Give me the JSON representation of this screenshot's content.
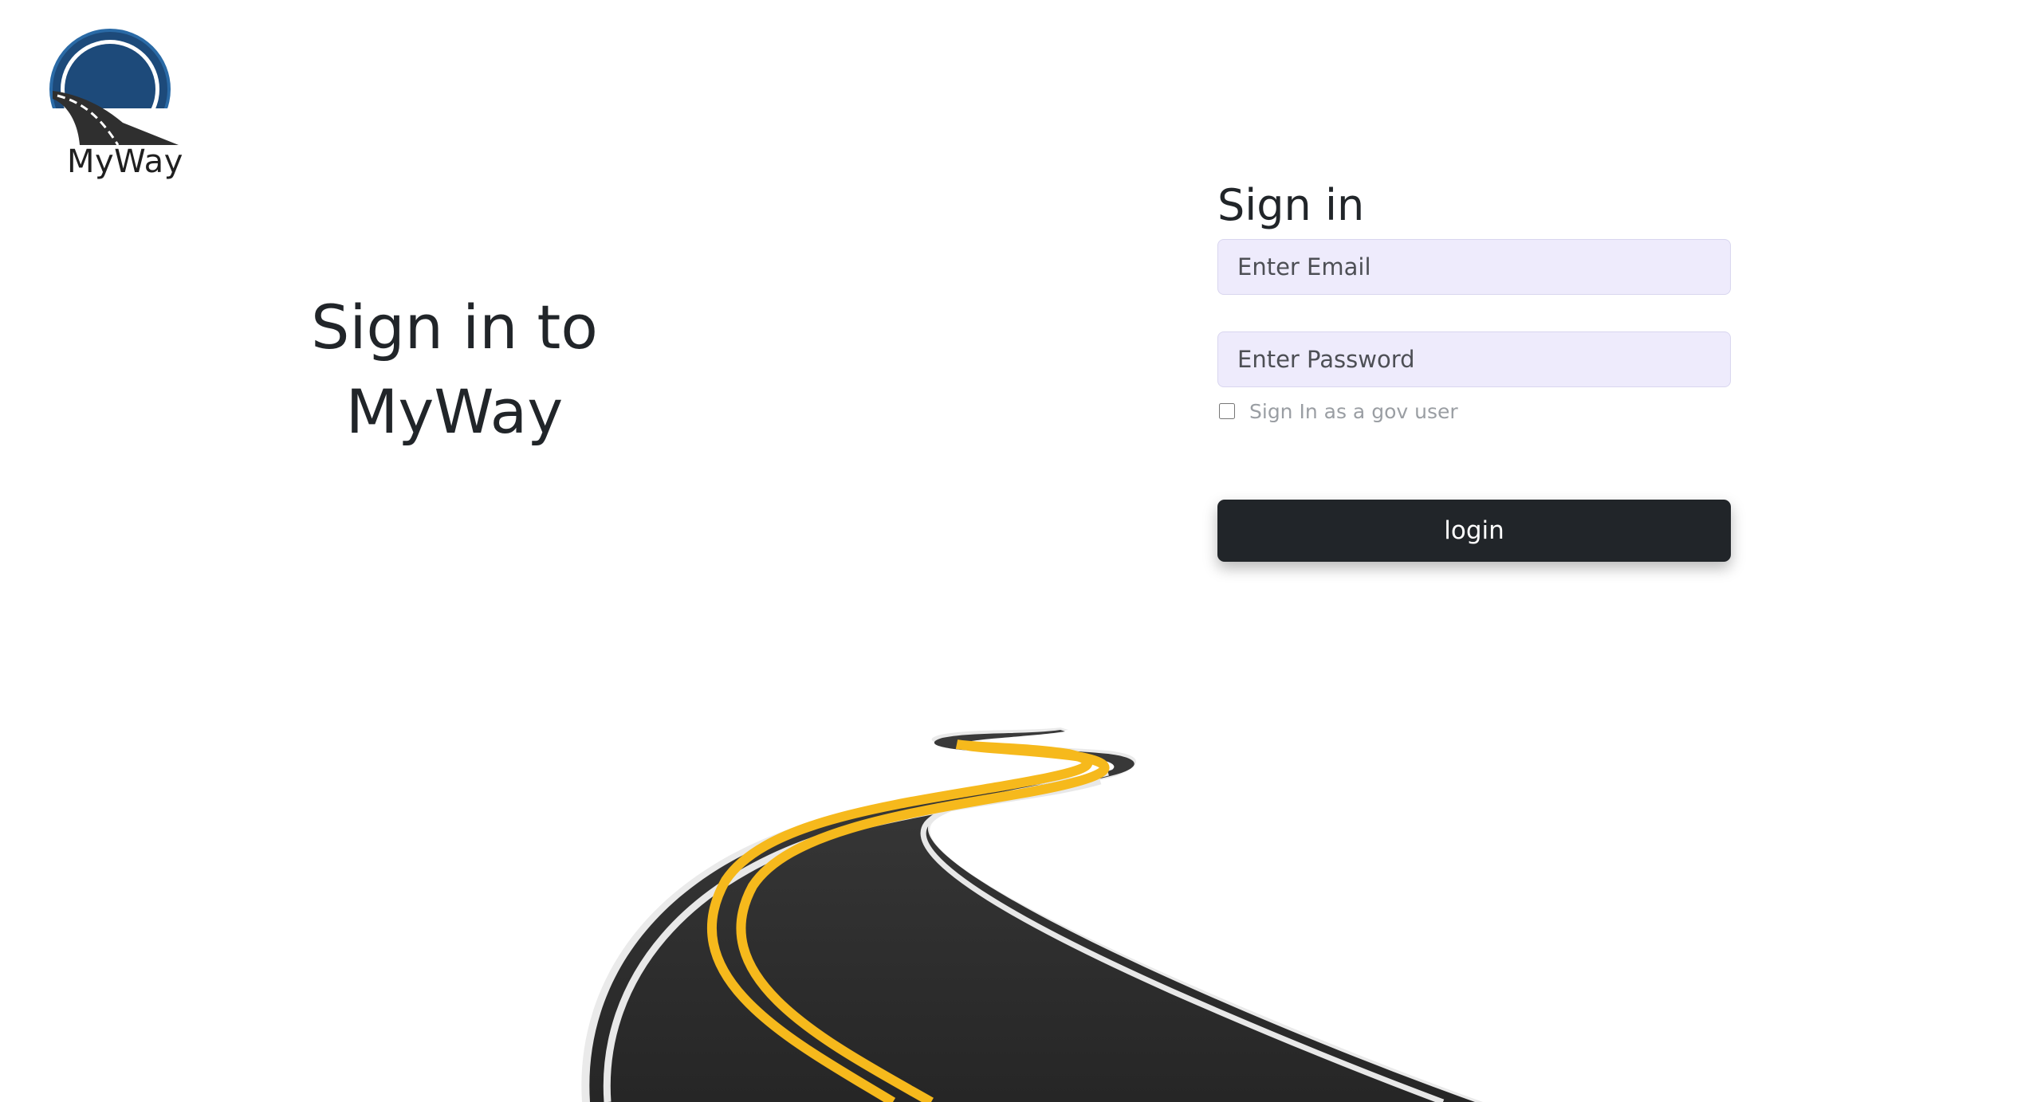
{
  "brand": {
    "name": "MyWay",
    "colors": {
      "ring": "#1d4a7a",
      "road": "#2b2b2b",
      "center_line": "#f6b91c",
      "edge_line": "#ffffff"
    }
  },
  "headline": {
    "line1": "Sign in to",
    "line2": "MyWay"
  },
  "form": {
    "title": "Sign in",
    "email_placeholder": "Enter Email",
    "password_placeholder": "Enter Password",
    "gov_user_label": "Sign In as a gov user",
    "gov_user_checked": false,
    "login_label": "login"
  },
  "colors": {
    "input_bg": "#eeebfc",
    "button_bg": "#212529",
    "button_text": "#ffffff",
    "muted_text": "#9a9ea3"
  }
}
